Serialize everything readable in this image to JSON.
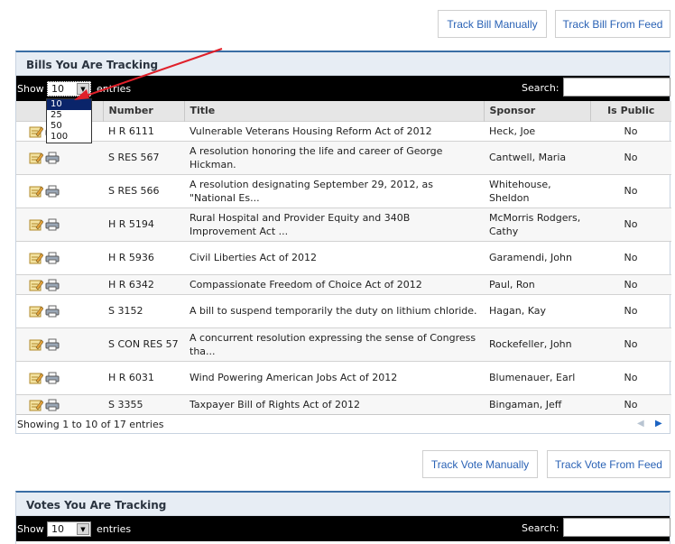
{
  "top_buttons": {
    "track_bill_manually": "Track Bill Manually",
    "track_bill_from_feed": "Track Bill From Feed"
  },
  "bills_panel": {
    "title": "Bills You Are Tracking",
    "show_label": "Show",
    "page_size": "10",
    "entries_label": "entries",
    "search_label": "Search:",
    "search_value": "",
    "page_size_options": [
      "10",
      "25",
      "50",
      "100"
    ],
    "columns": [
      "",
      "Number",
      "Title",
      "Sponsor",
      "Is Public"
    ],
    "rows": [
      {
        "number": "H R 6111",
        "title": "Vulnerable Veterans Housing Reform Act of 2012",
        "sponsor": "Heck, Joe",
        "public": "No"
      },
      {
        "number": "S RES 567",
        "title": "A resolution honoring the life and career of George Hickman.",
        "sponsor": "Cantwell, Maria",
        "public": "No"
      },
      {
        "number": "S RES 566",
        "title": "A resolution designating September 29, 2012, as \"National Es...",
        "sponsor": "Whitehouse, Sheldon",
        "public": "No"
      },
      {
        "number": "H R 5194",
        "title": "Rural Hospital and Provider Equity and 340B Improvement Act ...",
        "sponsor": "McMorris Rodgers, Cathy",
        "public": "No"
      },
      {
        "number": "H R 5936",
        "title": "Civil Liberties Act of 2012",
        "sponsor": "Garamendi, John",
        "public": "No"
      },
      {
        "number": "H R 6342",
        "title": "Compassionate Freedom of Choice Act of 2012",
        "sponsor": "Paul, Ron",
        "public": "No"
      },
      {
        "number": "S 3152",
        "title": "A bill to suspend temporarily the duty on lithium chloride.",
        "sponsor": "Hagan, Kay",
        "public": "No"
      },
      {
        "number": "S CON RES 57",
        "title": "A concurrent resolution expressing the sense of Congress tha...",
        "sponsor": "Rockefeller, John",
        "public": "No"
      },
      {
        "number": "H R 6031",
        "title": "Wind Powering American Jobs Act of 2012",
        "sponsor": "Blumenauer, Earl",
        "public": "No"
      },
      {
        "number": "S 3355",
        "title": "Taxpayer Bill of Rights Act of 2012",
        "sponsor": "Bingaman, Jeff",
        "public": "No"
      }
    ],
    "info": "Showing 1 to 10 of 17 entries"
  },
  "vote_buttons": {
    "track_vote_manually": "Track Vote Manually",
    "track_vote_from_feed": "Track Vote From Feed"
  },
  "votes_panel": {
    "title": "Votes You Are Tracking",
    "show_label": "Show",
    "page_size": "10",
    "entries_label": "entries",
    "search_label": "Search:",
    "search_value": ""
  },
  "colors": {
    "accent": "#3a6ea5",
    "link": "#2a62b5",
    "annotation_arrow": "#e0202a"
  }
}
